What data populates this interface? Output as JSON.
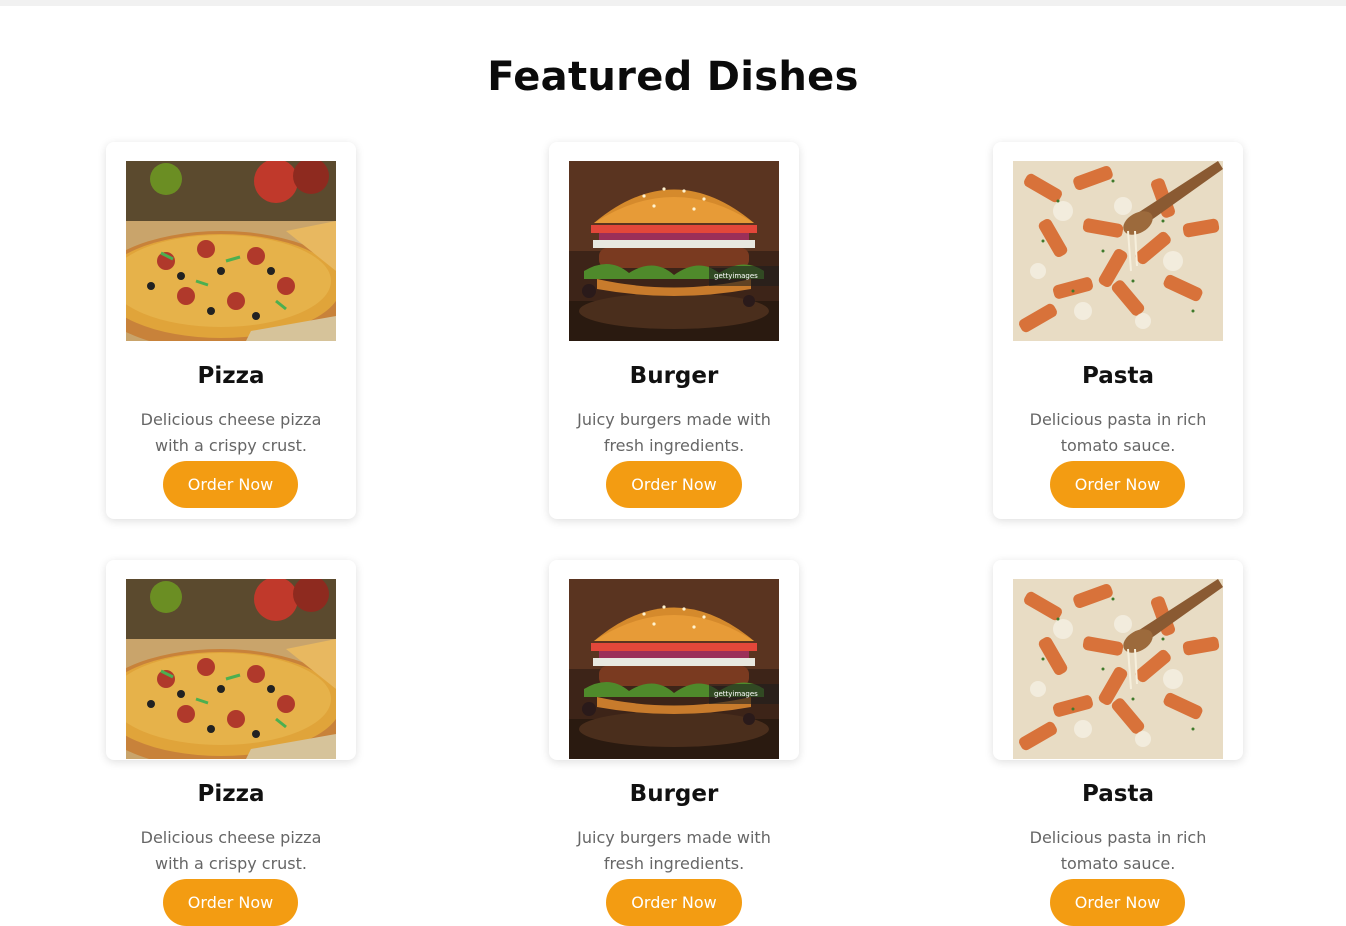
{
  "section": {
    "title": "Featured Dishes"
  },
  "dishes": [
    {
      "name": "Pizza",
      "description": "Delicious cheese pizza with a crispy crust.",
      "button": "Order Now",
      "image_icon": "pizza-image"
    },
    {
      "name": "Burger",
      "description": "Juicy burgers made with fresh ingredients.",
      "button": "Order Now",
      "image_icon": "burger-image"
    },
    {
      "name": "Pasta",
      "description": "Delicious pasta in rich tomato sauce.",
      "button": "Order Now",
      "image_icon": "pasta-image"
    },
    {
      "name": "Pizza",
      "description": "Delicious cheese pizza with a crispy crust.",
      "button": "Order Now",
      "image_icon": "pizza-image"
    },
    {
      "name": "Burger",
      "description": "Juicy burgers made with fresh ingredients.",
      "button": "Order Now",
      "image_icon": "burger-image"
    },
    {
      "name": "Pasta",
      "description": "Delicious pasta in rich tomato sauce.",
      "button": "Order Now",
      "image_icon": "pasta-image"
    }
  ],
  "image_watermark": "gettyimages",
  "colors": {
    "accent": "#f39c12",
    "heading": "#0b0b0b",
    "text_muted": "#666666"
  }
}
